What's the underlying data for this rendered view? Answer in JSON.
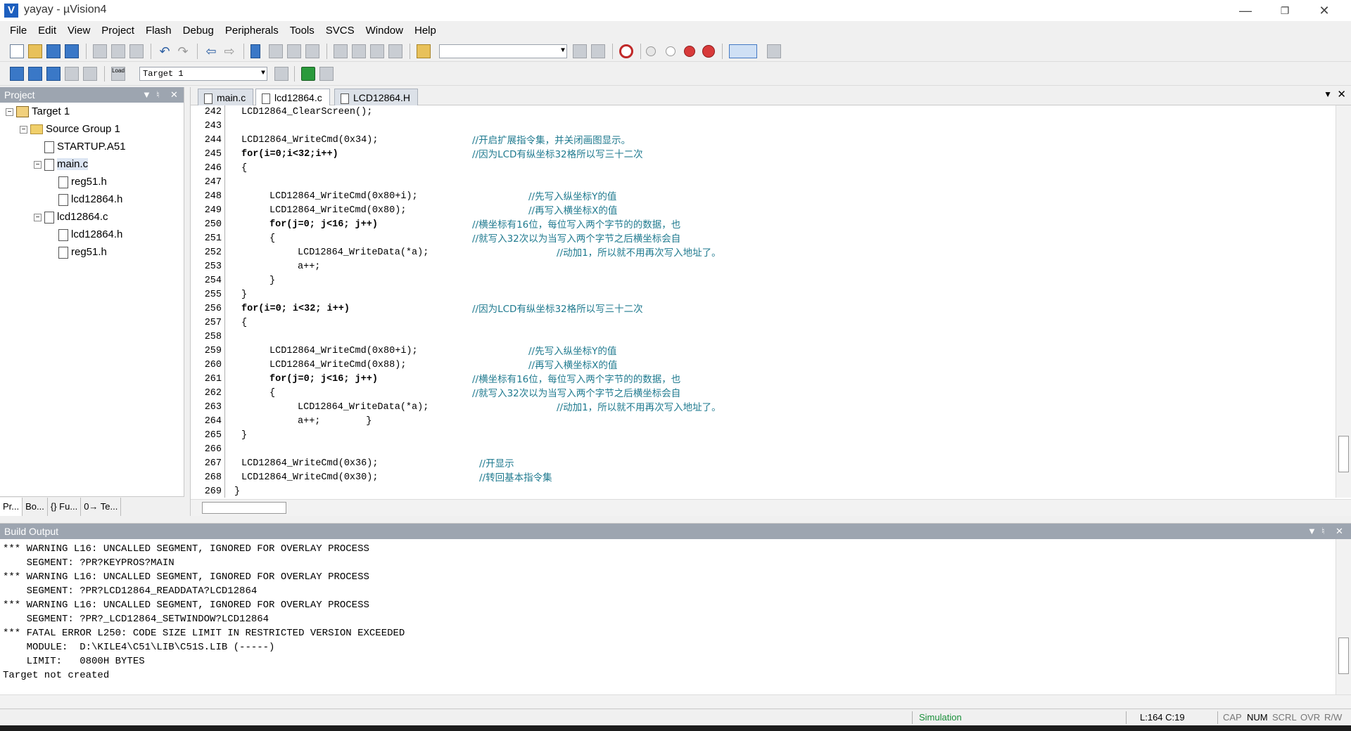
{
  "window": {
    "title": "yayay - µVision4",
    "app_icon_glyph": "V",
    "controls": [
      "minimize-icon",
      "restore-icon",
      "close-icon"
    ]
  },
  "menu": [
    "File",
    "Edit",
    "View",
    "Project",
    "Flash",
    "Debug",
    "Peripherals",
    "Tools",
    "SVCS",
    "Window",
    "Help"
  ],
  "toolbar2": {
    "target_select": "Target 1",
    "load_label": "Load"
  },
  "project_panel": {
    "title": "Project",
    "tree": [
      {
        "label": "Target 1",
        "level": 0,
        "type": "target",
        "expanded": true
      },
      {
        "label": "Source Group 1",
        "level": 1,
        "type": "folder",
        "expanded": true
      },
      {
        "label": "STARTUP.A51",
        "level": 2,
        "type": "file"
      },
      {
        "label": "main.c",
        "level": 2,
        "type": "file",
        "expanded": true,
        "selected": true
      },
      {
        "label": "reg51.h",
        "level": 3,
        "type": "file"
      },
      {
        "label": "lcd12864.h",
        "level": 3,
        "type": "file"
      },
      {
        "label": "lcd12864.c",
        "level": 2,
        "type": "file",
        "expanded": true
      },
      {
        "label": "lcd12864.h",
        "level": 3,
        "type": "file"
      },
      {
        "label": "reg51.h",
        "level": 3,
        "type": "file"
      }
    ],
    "tabs": [
      "Pr...",
      "Bo...",
      "{} Fu...",
      "0→ Te..."
    ]
  },
  "editor": {
    "tabs": [
      {
        "label": "main.c",
        "active": false
      },
      {
        "label": "lcd12864.c",
        "active": true
      },
      {
        "label": "LCD12864.H",
        "active": false
      }
    ],
    "lines": [
      {
        "n": "242",
        "code": "LCD12864_ClearScreen();",
        "indent": 1,
        "comment": ""
      },
      {
        "n": "243",
        "code": "",
        "indent": 0,
        "comment": ""
      },
      {
        "n": "244",
        "code": "LCD12864_WriteCmd(0x34);",
        "indent": 1,
        "comment": "//开启扩展指令集，并关闭画图显示。"
      },
      {
        "n": "245",
        "code": "for(i=0;i<32;i++)",
        "indent": 1,
        "comment": "//因为LCD有纵坐标32格所以写三十二次"
      },
      {
        "n": "246",
        "code": "{",
        "indent": 1,
        "comment": ""
      },
      {
        "n": "247",
        "code": "",
        "indent": 0,
        "comment": ""
      },
      {
        "n": "248",
        "code": "LCD12864_WriteCmd(0x80+i);",
        "indent": 2,
        "comment": "//先写入纵坐标Y的值"
      },
      {
        "n": "249",
        "code": "LCD12864_WriteCmd(0x80);",
        "indent": 2,
        "comment": "//再写入横坐标X的值"
      },
      {
        "n": "250",
        "code": "for(j=0; j<16; j++)",
        "indent": 2,
        "comment": "//横坐标有16位，每位写入两个字节的的数据，也"
      },
      {
        "n": "251",
        "code": "{",
        "indent": 2,
        "comment": "//就写入32次以为当写入两个字节之后横坐标会自"
      },
      {
        "n": "252",
        "code": "LCD12864_WriteData(*a);",
        "indent": 3,
        "comment": "//动加1，所以就不用再次写入地址了。"
      },
      {
        "n": "253",
        "code": "a++;",
        "indent": 3,
        "comment": ""
      },
      {
        "n": "254",
        "code": "}",
        "indent": 2,
        "comment": ""
      },
      {
        "n": "255",
        "code": "}",
        "indent": 1,
        "comment": ""
      },
      {
        "n": "256",
        "code": "for(i=0; i<32; i++)",
        "indent": 1,
        "comment": "//因为LCD有纵坐标32格所以写三十二次"
      },
      {
        "n": "257",
        "code": "{",
        "indent": 1,
        "comment": ""
      },
      {
        "n": "258",
        "code": "",
        "indent": 0,
        "comment": ""
      },
      {
        "n": "259",
        "code": "LCD12864_WriteCmd(0x80+i);",
        "indent": 2,
        "comment": "//先写入纵坐标Y的值"
      },
      {
        "n": "260",
        "code": "LCD12864_WriteCmd(0x88);",
        "indent": 2,
        "comment": "//再写入横坐标X的值"
      },
      {
        "n": "261",
        "code": "for(j=0; j<16; j++)",
        "indent": 2,
        "comment": "//横坐标有16位，每位写入两个字节的的数据，也"
      },
      {
        "n": "262",
        "code": "{",
        "indent": 2,
        "comment": "//就写入32次以为当写入两个字节之后横坐标会自"
      },
      {
        "n": "263",
        "code": "LCD12864_WriteData(*a);",
        "indent": 3,
        "comment": "//动加1，所以就不用再次写入地址了。"
      },
      {
        "n": "264",
        "code": "a++;        }",
        "indent": 3,
        "comment": ""
      },
      {
        "n": "265",
        "code": "}",
        "indent": 1,
        "comment": ""
      },
      {
        "n": "266",
        "code": "",
        "indent": 0,
        "comment": ""
      },
      {
        "n": "267",
        "code": "LCD12864_WriteCmd(0x36);",
        "indent": 1,
        "comment": "//开显示"
      },
      {
        "n": "268",
        "code": "LCD12864_WriteCmd(0x30);",
        "indent": 1,
        "comment": "//转回基本指令集"
      },
      {
        "n": "269",
        "code": "}",
        "indent": 0,
        "comment": ""
      }
    ]
  },
  "build_output": {
    "title": "Build Output",
    "lines": [
      "*** WARNING L16: UNCALLED SEGMENT, IGNORED FOR OVERLAY PROCESS",
      "    SEGMENT: ?PR?KEYPROS?MAIN",
      "*** WARNING L16: UNCALLED SEGMENT, IGNORED FOR OVERLAY PROCESS",
      "    SEGMENT: ?PR?LCD12864_READDATA?LCD12864",
      "*** WARNING L16: UNCALLED SEGMENT, IGNORED FOR OVERLAY PROCESS",
      "    SEGMENT: ?PR?_LCD12864_SETWINDOW?LCD12864",
      "*** FATAL ERROR L250: CODE SIZE LIMIT IN RESTRICTED VERSION EXCEEDED",
      "    MODULE:  D:\\KILE4\\C51\\LIB\\C51S.LIB (-----)",
      "    LIMIT:   0800H BYTES",
      "Target not created"
    ]
  },
  "status": {
    "mode": "Simulation",
    "cursor": "L:164 C:19",
    "cap": "CAP",
    "num": "NUM",
    "scrl": "SCRL",
    "ovr": "OVR",
    "rw": "R/W"
  },
  "colors": {
    "panel_header": "#9da5b0",
    "mode_text": "#1a8f3a",
    "comment_text": "#1f7a8f",
    "number_text": "#8a1d8a"
  }
}
